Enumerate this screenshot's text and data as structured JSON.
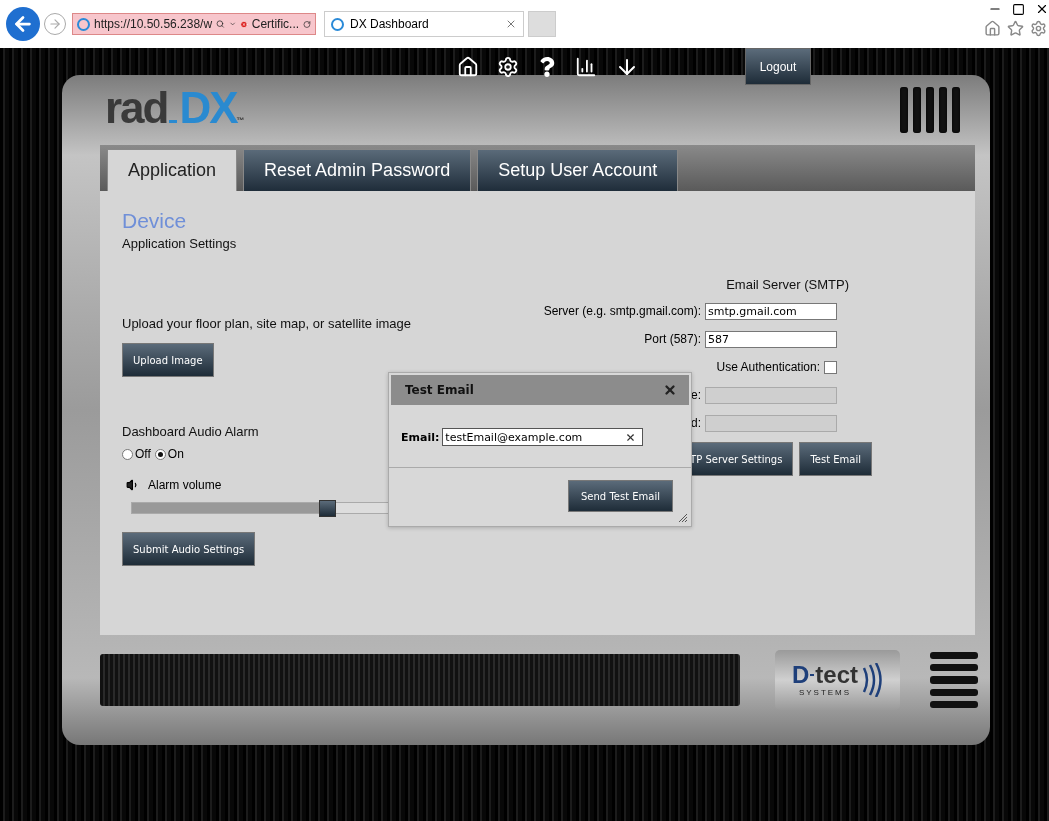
{
  "browser": {
    "address": "https://10.50.56.238/w",
    "cert_label": "Certific...",
    "tab_title": "DX Dashboard"
  },
  "logo": {
    "name": "rad",
    "accent": "DX",
    "mark": "™"
  },
  "logout": "Logout",
  "tabs": [
    {
      "label": "Application",
      "selected": true
    },
    {
      "label": "Reset Admin Password",
      "selected": false
    },
    {
      "label": "Setup User Account",
      "selected": false
    }
  ],
  "section": {
    "title": "Device",
    "subtitle": "Application Settings"
  },
  "upload": {
    "prompt": "Upload your floor plan, site map, or satellite image",
    "button": "Upload Image"
  },
  "audio": {
    "title": "Dashboard Audio Alarm",
    "options": [
      {
        "label": "Off",
        "selected": false
      },
      {
        "label": "On",
        "selected": true
      }
    ],
    "volume_label": "Alarm volume",
    "level": 0.56,
    "button": "Submit Audio Settings"
  },
  "smtp": {
    "title": "Email Server (SMTP)",
    "fields": [
      {
        "kind": "text",
        "label": "Server (e.g. smtp.gmail.com):",
        "value": "smtp.gmail.com",
        "disabled": false
      },
      {
        "kind": "text",
        "label": "Port (587):",
        "value": "587",
        "disabled": false
      },
      {
        "kind": "checkbox",
        "label": "Use Authentication:",
        "checked": false
      },
      {
        "kind": "text",
        "label": "e:",
        "disabled": true
      },
      {
        "kind": "text",
        "label": "d:",
        "disabled": true
      }
    ],
    "buttons": [
      "TP Server Settings",
      "Test Email"
    ]
  },
  "dialog": {
    "title": "Test Email",
    "field_label": "Email:",
    "value": "testEmail@example.com",
    "button": "Send Test Email"
  },
  "brand": {
    "mark": "D",
    "name": "tect",
    "tagline": "SYSTEMS"
  }
}
